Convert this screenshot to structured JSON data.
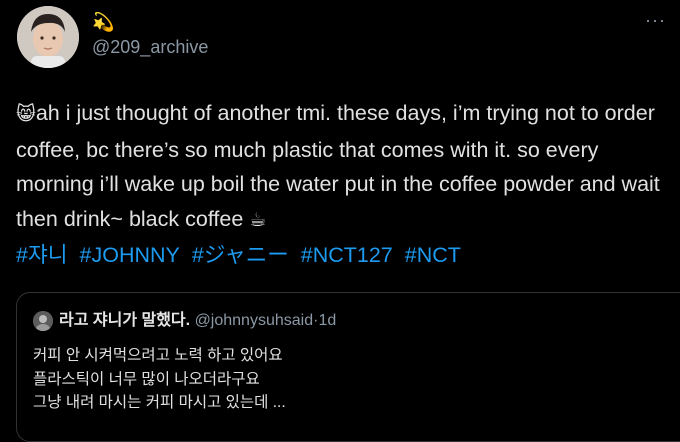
{
  "tweet": {
    "name_emoji": "💫",
    "handle": "@209_archive",
    "more_icon": "···",
    "text_emoji_start": "😸",
    "text": "ah i just thought of another tmi. these days, i’m trying not to order coffee, bc there’s so much plastic that comes with it. so every morning i’ll wake up boil the water put in the coffee powder and wait then drink~ black coffee",
    "text_emoji_end": "☕",
    "hashtags": [
      "#쟈니",
      "#JOHNNY",
      "#ジャニー",
      "#NCT127",
      "#NCT"
    ]
  },
  "quote": {
    "name": "라고 쟈니가 말했다.",
    "handle": "@johnnysuhsaid",
    "dot": "·",
    "time": "1d",
    "lines": [
      "커피 안 시켜먹으려고 노력 하고 있어요",
      "플라스틱이 너무 많이 나오더라구요",
      "그냥 내려 마시는 커피 마시고 있는데 ..."
    ]
  },
  "colors": {
    "background": "#000000",
    "text": "#e1e1e1",
    "secondary": "#8b98a5",
    "link": "#1d9bf0",
    "border": "#2f3336"
  },
  "icons": {
    "avatar": "user-avatar-photo",
    "more": "more-horizontal-icon",
    "quote_avatar": "quoted-user-avatar"
  }
}
